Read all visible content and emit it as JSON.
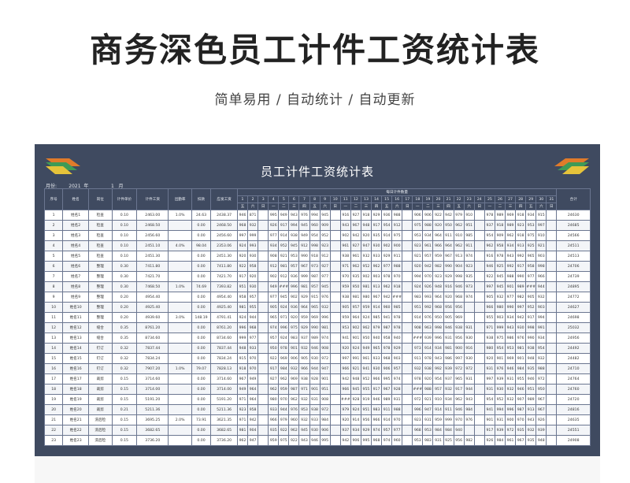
{
  "page": {
    "title": "商务深色员工计件工资统计表",
    "subtitle": "简单易用 / 自动统计 / 自动更新"
  },
  "sheet": {
    "title": "员工计件工资统计表",
    "meta_text": "月份:        2021  年               1   月",
    "header": {
      "cols": [
        "序号",
        "姓名",
        "岗位",
        "计件单价",
        "计件工资",
        "出勤率",
        "扣款",
        "应发工资"
      ],
      "daily_label": "每日计件数量",
      "total_label": "合计",
      "days": [
        "1",
        "2",
        "3",
        "4",
        "5",
        "6",
        "7",
        "8",
        "9",
        "10",
        "11",
        "12",
        "13",
        "14",
        "15",
        "16",
        "17",
        "18",
        "19",
        "20",
        "21",
        "22",
        "23",
        "24",
        "25",
        "26",
        "27",
        "28",
        "29",
        "30",
        "31"
      ],
      "weekdays": [
        "五",
        "六",
        "日",
        "一",
        "二",
        "三",
        "四",
        "五",
        "六",
        "日",
        "一",
        "二",
        "三",
        "四",
        "五",
        "六",
        "日",
        "一",
        "二",
        "三",
        "四",
        "五",
        "六",
        "日",
        "一",
        "二",
        "三",
        "四",
        "五",
        "六",
        "日"
      ]
    },
    "rows": [
      {
        "seq": "1",
        "name": "姓名1",
        "post": "检查",
        "price": "0.10",
        "piece": "2463.00",
        "att": "1.0%",
        "ded": "24.63",
        "pay": "2438.37",
        "days": [
          "946",
          "871",
          "",
          "995",
          "949",
          "943",
          "976",
          "994",
          "945",
          "",
          "916",
          "927",
          "918",
          "929",
          "936",
          "988",
          "",
          "906",
          "906",
          "922",
          "942",
          "979",
          "910",
          "",
          "978",
          "989",
          "969",
          "918",
          "934",
          "915",
          ""
        ],
        "total": "24630"
      },
      {
        "seq": "2",
        "name": "姓名2",
        "post": "检查",
        "price": "0.10",
        "piece": "2468.50",
        "att": "",
        "ded": "0.00",
        "pay": "2468.50",
        "days": [
          "968",
          "932",
          "",
          "926",
          "917",
          "994",
          "945",
          "960",
          "909",
          "",
          "943",
          "967",
          "948",
          "917",
          "954",
          "912",
          "",
          "975",
          "988",
          "920",
          "950",
          "962",
          "951",
          "",
          "937",
          "918",
          "989",
          "923",
          "953",
          "997",
          ""
        ],
        "total": "24685"
      },
      {
        "seq": "3",
        "name": "姓名3",
        "post": "检查",
        "price": "0.10",
        "piece": "2456.60",
        "att": "",
        "ded": "0.00",
        "pay": "2456.60",
        "days": [
          "997",
          "999",
          "",
          "977",
          "914",
          "938",
          "949",
          "954",
          "952",
          "",
          "902",
          "942",
          "920",
          "935",
          "914",
          "975",
          "",
          "953",
          "934",
          "964",
          "911",
          "910",
          "985",
          "",
          "954",
          "909",
          "962",
          "918",
          "975",
          "910",
          ""
        ],
        "total": "24566"
      },
      {
        "seq": "4",
        "name": "姓名4",
        "post": "检查",
        "price": "0.10",
        "piece": "2451.10",
        "att": "4.0%",
        "ded": "98.04",
        "pay": "2353.06",
        "days": [
          "924",
          "993",
          "",
          "934",
          "952",
          "945",
          "912",
          "998",
          "923",
          "",
          "961",
          "927",
          "947",
          "930",
          "902",
          "900",
          "",
          "923",
          "961",
          "966",
          "964",
          "962",
          "911",
          "",
          "962",
          "958",
          "934",
          "913",
          "925",
          "921",
          ""
        ],
        "total": "24511"
      },
      {
        "seq": "5",
        "name": "姓名5",
        "post": "检查",
        "price": "0.10",
        "piece": "2451.30",
        "att": "",
        "ded": "0.00",
        "pay": "2451.30",
        "days": [
          "920",
          "930",
          "",
          "908",
          "921",
          "953",
          "990",
          "918",
          "912",
          "",
          "938",
          "961",
          "932",
          "933",
          "929",
          "911",
          "",
          "921",
          "957",
          "959",
          "967",
          "913",
          "974",
          "",
          "916",
          "978",
          "943",
          "992",
          "965",
          "903",
          ""
        ],
        "total": "24513"
      },
      {
        "seq": "6",
        "name": "姓名6",
        "post": "整理",
        "price": "0.30",
        "piece": "7411.80",
        "att": "",
        "ded": "0.00",
        "pay": "7411.80",
        "days": [
          "922",
          "958",
          "",
          "912",
          "981",
          "957",
          "967",
          "973",
          "927",
          "",
          "971",
          "962",
          "952",
          "962",
          "977",
          "988",
          "",
          "920",
          "942",
          "982",
          "990",
          "904",
          "923",
          "",
          "946",
          "925",
          "992",
          "917",
          "958",
          "998",
          ""
        ],
        "total": "24706"
      },
      {
        "seq": "7",
        "name": "姓名7",
        "post": "整理",
        "price": "0.30",
        "piece": "7421.70",
        "att": "",
        "ded": "0.00",
        "pay": "7421.70",
        "days": [
          "917",
          "920",
          "",
          "902",
          "912",
          "936",
          "999",
          "987",
          "977",
          "",
          "970",
          "935",
          "902",
          "903",
          "978",
          "970",
          "",
          "994",
          "970",
          "923",
          "929",
          "998",
          "935",
          "",
          "922",
          "945",
          "988",
          "990",
          "977",
          "966",
          ""
        ],
        "total": "24739"
      },
      {
        "seq": "8",
        "name": "姓名8",
        "post": "整理",
        "price": "0.30",
        "piece": "7468.50",
        "att": "1.0%",
        "ded": "74.69",
        "pay": "7393.82",
        "days": [
          "951",
          "930",
          "",
          "949",
          "###",
          "996",
          "981",
          "957",
          "945",
          "",
          "959",
          "950",
          "981",
          "913",
          "962",
          "918",
          "",
          "924",
          "926",
          "948",
          "916",
          "946",
          "973",
          "",
          "997",
          "945",
          "901",
          "989",
          "###",
          "944",
          ""
        ],
        "total": "24895"
      },
      {
        "seq": "9",
        "name": "姓名9",
        "post": "整理",
        "price": "0.20",
        "piece": "4954.40",
        "att": "",
        "ded": "0.00",
        "pay": "4954.40",
        "days": [
          "958",
          "957",
          "",
          "977",
          "945",
          "902",
          "929",
          "915",
          "976",
          "",
          "938",
          "981",
          "980",
          "967",
          "942",
          "###",
          "",
          "983",
          "993",
          "964",
          "920",
          "968",
          "974",
          "",
          "905",
          "932",
          "977",
          "982",
          "905",
          "932",
          ""
        ],
        "total": "24772"
      },
      {
        "seq": "10",
        "name": "姓名10",
        "post": "整理",
        "price": "0.20",
        "piece": "4925.40",
        "att": "",
        "ded": "0.00",
        "pay": "4925.40",
        "days": [
          "981",
          "955",
          "",
          "905",
          "924",
          "936",
          "964",
          "965",
          "932",
          "",
          "905",
          "957",
          "959",
          "914",
          "960",
          "985",
          "",
          "951",
          "992",
          "968",
          "956",
          "956",
          "",
          "",
          "966",
          "980",
          "990",
          "997",
          "952",
          "903",
          ""
        ],
        "total": "24627"
      },
      {
        "seq": "11",
        "name": "姓名11",
        "post": "整理",
        "price": "0.20",
        "piece": "4939.60",
        "att": "3.0%",
        "ded": "148.19",
        "pay": "4791.41",
        "days": [
          "924",
          "944",
          "",
          "965",
          "971",
          "920",
          "959",
          "969",
          "996",
          "",
          "959",
          "964",
          "924",
          "985",
          "941",
          "978",
          "",
          "914",
          "976",
          "950",
          "905",
          "969",
          "",
          "",
          "955",
          "903",
          "934",
          "942",
          "917",
          "994",
          ""
        ],
        "total": "24698"
      },
      {
        "seq": "12",
        "name": "姓名12",
        "post": "缝合",
        "price": "0.35",
        "piece": "8761.20",
        "att": "",
        "ded": "0.00",
        "pay": "8761.20",
        "days": [
          "996",
          "968",
          "",
          "974",
          "996",
          "975",
          "929",
          "990",
          "981",
          "",
          "953",
          "902",
          "962",
          "979",
          "987",
          "978",
          "",
          "908",
          "963",
          "998",
          "946",
          "938",
          "931",
          "",
          "971",
          "999",
          "943",
          "930",
          "998",
          "991",
          ""
        ],
        "total": "25032"
      },
      {
        "seq": "13",
        "name": "姓名13",
        "post": "缝合",
        "price": "0.35",
        "piece": "8734.60",
        "att": "",
        "ded": "0.00",
        "pay": "8734.60",
        "days": [
          "999",
          "977",
          "",
          "957",
          "924",
          "983",
          "937",
          "989",
          "974",
          "",
          "941",
          "901",
          "950",
          "940",
          "958",
          "940",
          "",
          "###",
          "939",
          "996",
          "931",
          "956",
          "930",
          "",
          "938",
          "975",
          "986",
          "976",
          "990",
          "934",
          ""
        ],
        "total": "24956"
      },
      {
        "seq": "14",
        "name": "姓名14",
        "post": "钉订",
        "price": "0.32",
        "piece": "7837.44",
        "att": "",
        "ded": "0.00",
        "pay": "7837.44",
        "days": [
          "948",
          "933",
          "",
          "950",
          "978",
          "901",
          "932",
          "946",
          "908",
          "",
          "920",
          "924",
          "949",
          "965",
          "978",
          "929",
          "",
          "973",
          "914",
          "934",
          "981",
          "900",
          "916",
          "",
          "980",
          "954",
          "953",
          "981",
          "938",
          "954",
          ""
        ],
        "total": "24492"
      },
      {
        "seq": "15",
        "name": "姓名15",
        "post": "钉订",
        "price": "0.32",
        "piece": "7834.24",
        "att": "",
        "ded": "0.00",
        "pay": "7834.24",
        "days": [
          "915",
          "970",
          "",
          "922",
          "969",
          "906",
          "905",
          "930",
          "972",
          "",
          "997",
          "991",
          "961",
          "933",
          "968",
          "903",
          "",
          "911",
          "978",
          "943",
          "986",
          "997",
          "930",
          "",
          "920",
          "901",
          "969",
          "901",
          "948",
          "932",
          ""
        ],
        "total": "24482"
      },
      {
        "seq": "16",
        "name": "姓名16",
        "post": "钉订",
        "price": "0.32",
        "piece": "7907.20",
        "att": "1.0%",
        "ded": "79.07",
        "pay": "7828.13",
        "days": [
          "918",
          "970",
          "",
          "917",
          "984",
          "932",
          "966",
          "944",
          "947",
          "",
          "966",
          "921",
          "941",
          "930",
          "906",
          "957",
          "",
          "932",
          "938",
          "992",
          "939",
          "972",
          "972",
          "",
          "931",
          "976",
          "946",
          "984",
          "935",
          "988",
          ""
        ],
        "total": "24710"
      },
      {
        "seq": "17",
        "name": "姓名17",
        "post": "裁剪",
        "price": "0.15",
        "piece": "3714.60",
        "att": "",
        "ded": "0.00",
        "pay": "3714.60",
        "days": [
          "967",
          "949",
          "",
          "927",
          "962",
          "969",
          "938",
          "928",
          "901",
          "",
          "942",
          "948",
          "952",
          "966",
          "995",
          "974",
          "",
          "978",
          "920",
          "954",
          "937",
          "965",
          "931",
          "",
          "997",
          "939",
          "931",
          "955",
          "946",
          "972",
          ""
        ],
        "total": "24764"
      },
      {
        "seq": "18",
        "name": "姓名18",
        "post": "裁剪",
        "price": "0.15",
        "piece": "3714.00",
        "att": "",
        "ded": "0.00",
        "pay": "3714.00",
        "days": [
          "949",
          "964",
          "",
          "962",
          "959",
          "987",
          "971",
          "901",
          "951",
          "",
          "966",
          "945",
          "955",
          "917",
          "967",
          "928",
          "",
          "###",
          "988",
          "957",
          "932",
          "917",
          "944",
          "",
          "931",
          "930",
          "932",
          "946",
          "951",
          "950",
          ""
        ],
        "total": "24760"
      },
      {
        "seq": "19",
        "name": "姓名19",
        "post": "裁剪",
        "price": "0.15",
        "piece": "5191.20",
        "att": "",
        "ded": "0.00",
        "pay": "5191.20",
        "days": [
          "971",
          "964",
          "",
          "980",
          "970",
          "962",
          "932",
          "931",
          "908",
          "",
          "###",
          "928",
          "919",
          "946",
          "989",
          "931",
          "",
          "972",
          "921",
          "910",
          "934",
          "962",
          "943",
          "",
          "954",
          "952",
          "932",
          "907",
          "989",
          "967",
          ""
        ],
        "total": "24720"
      },
      {
        "seq": "20",
        "name": "姓名20",
        "post": "裁剪",
        "price": "0.21",
        "piece": "5211.36",
        "att": "",
        "ded": "0.00",
        "pay": "5211.36",
        "days": [
          "923",
          "958",
          "",
          "933",
          "944",
          "976",
          "953",
          "938",
          "972",
          "",
          "979",
          "924",
          "951",
          "983",
          "911",
          "988",
          "",
          "996",
          "947",
          "914",
          "911",
          "946",
          "984",
          "",
          "941",
          "994",
          "996",
          "987",
          "913",
          "967",
          ""
        ],
        "total": "24816"
      },
      {
        "seq": "21",
        "name": "姓名21",
        "post": "洗后检",
        "price": "0.15",
        "piece": "3695.25",
        "att": "2.0%",
        "ded": "73.91",
        "pay": "3621.35",
        "days": [
          "971",
          "942",
          "",
          "966",
          "979",
          "960",
          "932",
          "933",
          "984",
          "",
          "920",
          "914",
          "956",
          "966",
          "914",
          "970",
          "",
          "923",
          "931",
          "959",
          "999",
          "970",
          "976",
          "",
          "901",
          "931",
          "900",
          "970",
          "943",
          "926",
          ""
        ],
        "total": "24635"
      },
      {
        "seq": "22",
        "name": "姓名22",
        "post": "洗后检",
        "price": "0.15",
        "piece": "3682.65",
        "att": "",
        "ded": "0.00",
        "pay": "3682.65",
        "days": [
          "981",
          "904",
          "",
          "935",
          "922",
          "962",
          "945",
          "930",
          "906",
          "",
          "937",
          "934",
          "929",
          "974",
          "957",
          "977",
          "",
          "968",
          "953",
          "984",
          "984",
          "940",
          "",
          "",
          "917",
          "939",
          "972",
          "935",
          "932",
          "939",
          ""
        ],
        "total": "24551"
      },
      {
        "seq": "23",
        "name": "姓名23",
        "post": "洗后检",
        "price": "0.15",
        "piece": "3736.20",
        "att": "",
        "ded": "0.00",
        "pay": "3736.20",
        "days": [
          "962",
          "947",
          "",
          "959",
          "975",
          "922",
          "943",
          "946",
          "995",
          "",
          "942",
          "906",
          "995",
          "968",
          "974",
          "960",
          "",
          "953",
          "983",
          "931",
          "925",
          "956",
          "982",
          "",
          "926",
          "984",
          "961",
          "967",
          "935",
          "948",
          ""
        ],
        "total": "24908"
      }
    ]
  },
  "colors": {
    "sheet_bg": "#3f4a60",
    "deco_orange": "#e07b2a",
    "deco_green": "#3f9b56",
    "deco_yellow": "#e6c33a"
  }
}
